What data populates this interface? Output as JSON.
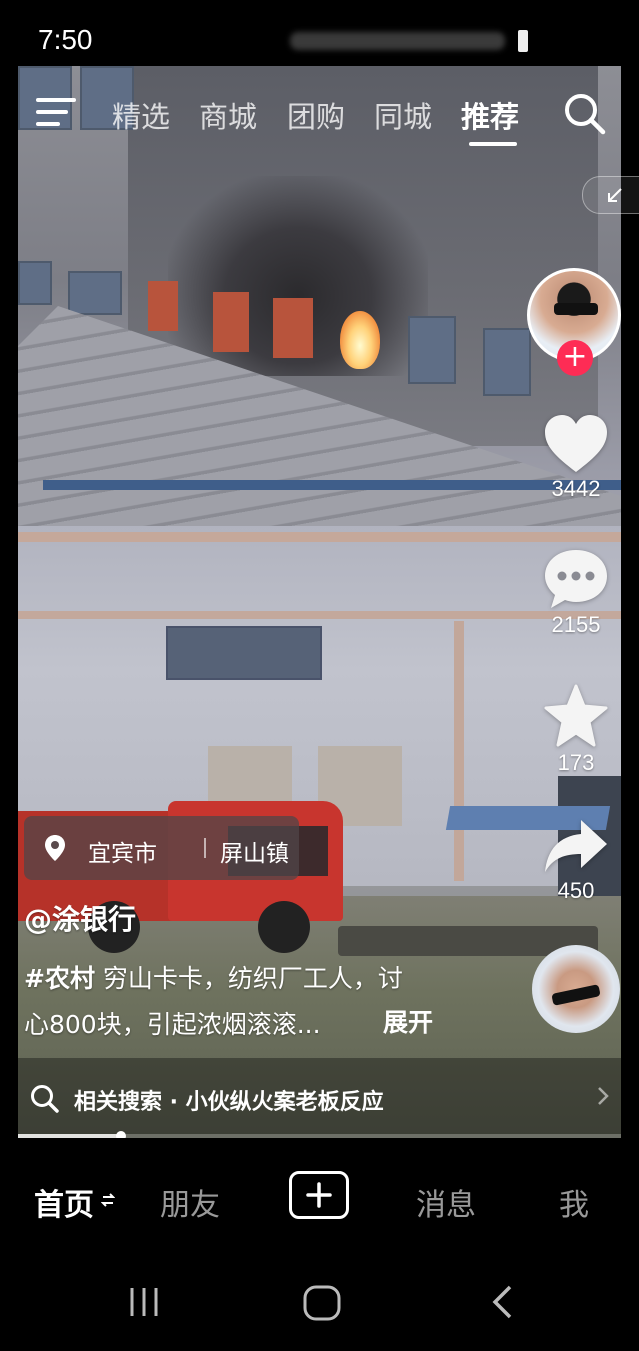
{
  "status_bar": {
    "time": "7:50"
  },
  "top_nav": {
    "tabs": [
      {
        "label": "精选",
        "active": false
      },
      {
        "label": "商城",
        "active": false
      },
      {
        "label": "团购",
        "active": false
      },
      {
        "label": "同城",
        "active": false
      },
      {
        "label": "推荐",
        "active": true
      }
    ],
    "icons": [
      "menu-icon",
      "search-icon"
    ]
  },
  "video": {
    "location": {
      "city": "宜宾市",
      "town": "屏山镇"
    },
    "author": "@涂银行",
    "hashtag": "#农村",
    "description_line1": " 穷山卡卡，纺织厂工人，讨",
    "description_line2": "心800块，引起浓烟滚滚...",
    "expand_label": "展开",
    "progress": 0.17
  },
  "actions": {
    "likes": "3442",
    "comments": "2155",
    "favorites": "173",
    "shares": "450",
    "follow_symbol": "+"
  },
  "related_search": {
    "text": "相关搜索 · 小伙纵火案老板反应"
  },
  "bottom_nav": {
    "home": "首页",
    "friends": "朋友",
    "messages": "消息",
    "me": "我"
  },
  "colors": {
    "accent": "#fe2c55",
    "background": "#000000",
    "text": "#ffffff"
  }
}
